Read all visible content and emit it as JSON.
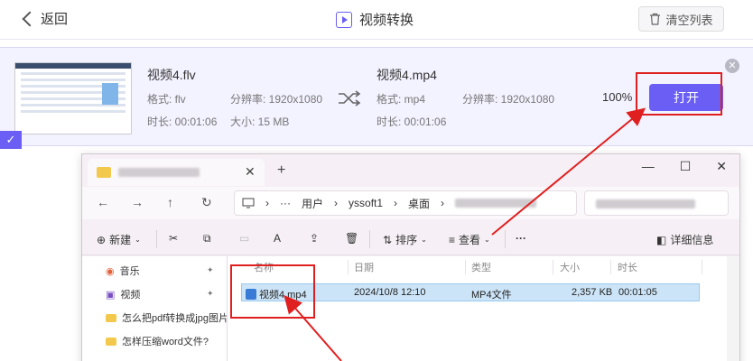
{
  "topbar": {
    "back_label": "返回",
    "title": "视频转换",
    "clear_label": "清空列表"
  },
  "card": {
    "source": {
      "name": "视频4.flv",
      "format": "格式: flv",
      "resolution": "分辨率: 1920x1080",
      "duration": "时长: 00:01:06",
      "size": "大小: 15 MB"
    },
    "target": {
      "name": "视频4.mp4",
      "format": "格式: mp4",
      "resolution": "分辨率: 1920x1080",
      "duration": "时长: 00:01:06"
    },
    "progress": "100%",
    "open_label": "打开",
    "check_mark": "✓",
    "close_mark": "✕"
  },
  "explorer": {
    "tab_close": "✕",
    "tab_add": "+",
    "window_buttons": {
      "minimize": "—",
      "maximize": "☐",
      "close": "✕"
    },
    "nav": {
      "back": "←",
      "forward": "→",
      "up": "↑",
      "refresh": "↻"
    },
    "address": {
      "ellipsis": "···",
      "user": "用户",
      "account": "yssoft1",
      "desktop": "桌面"
    },
    "commands": {
      "new": "新建",
      "sort": "排序",
      "view": "查看",
      "more": "···",
      "details": "详细信息"
    },
    "sidebar": [
      {
        "label": "音乐",
        "pinned": true
      },
      {
        "label": "视频",
        "pinned": true
      },
      {
        "label": "怎么把pdf转换成jpg图片",
        "pinned": false
      },
      {
        "label": "怎样压缩word文件?",
        "pinned": false
      }
    ],
    "columns": {
      "name": "名称",
      "date": "日期",
      "type": "类型",
      "size": "大小",
      "duration": "时长"
    },
    "file": {
      "name": "视频4.mp4",
      "date": "2024/10/8 12:10",
      "type": "MP4文件",
      "size": "2,357 KB",
      "duration": "00:01:05"
    }
  },
  "colors": {
    "accent": "#6a5ef4",
    "annotation": "#e02020",
    "selection": "#cce4f7"
  }
}
